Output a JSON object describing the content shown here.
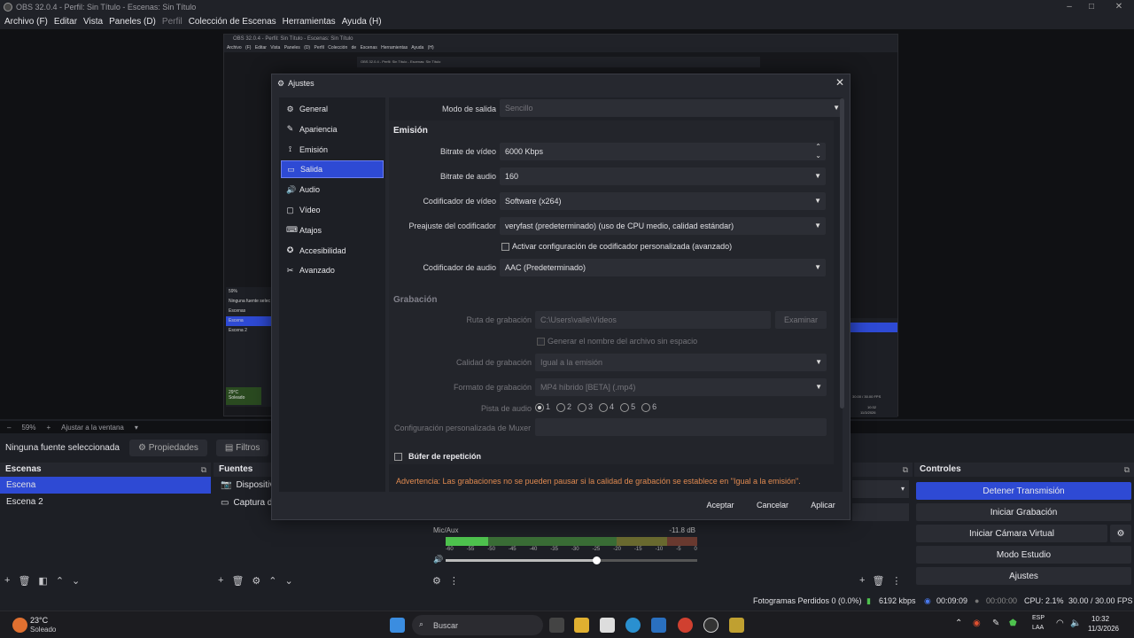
{
  "window": {
    "title": "OBS 32.0.4 - Perfil: Sin Título - Escenas: Sin Título"
  },
  "menu": [
    "Archivo (F)",
    "Editar",
    "Vista",
    "Paneles (D)",
    "Perfil",
    "Colección de Escenas",
    "Herramientas",
    "Ayuda (H)"
  ],
  "preview": {
    "zoom": "59%",
    "fit": "Ajustar a la ventana",
    "no_source": "Ninguna fuente seleccionada",
    "properties": "Propiedades",
    "filters": "Filtros"
  },
  "scenes_dock": {
    "title": "Escenas",
    "items": [
      "Escena",
      "Escena 2"
    ]
  },
  "sources_dock": {
    "title": "Fuentes",
    "items": [
      "Dispositivo",
      "Captura de"
    ]
  },
  "mixer": {
    "name": "Mic/Aux",
    "db": "-11.8 dB",
    "scale": [
      "-60",
      "-55",
      "-50",
      "-45",
      "-40",
      "-35",
      "-30",
      "-25",
      "-20",
      "-15",
      "-10",
      "-5",
      "0"
    ],
    "level": 0.17,
    "volume": 0.6
  },
  "controls": {
    "title": "Controles",
    "buttons": [
      "Detener Transmisión",
      "Iniciar Grabación",
      "Iniciar Cámara Virtual",
      "Modo Estudio",
      "Ajustes"
    ]
  },
  "status": {
    "dropped": "Fotogramas Perdidos 0 (0.0%)",
    "bitrate": "6192 kbps",
    "stream_time": "00:09:09",
    "rec_time": "00:00:00",
    "cpu": "CPU: 2.1%",
    "fps": "30.00 / 30.00 FPS"
  },
  "taskbar": {
    "weather_temp": "23°C",
    "weather_desc": "Soleado",
    "search": "Buscar",
    "lang1": "ESP",
    "lang2": "LAA",
    "time": "10:32",
    "date": "11/3/2026"
  },
  "nested": {
    "title": "OBS 32.0.4 - Perfil: Sin Título - Escenas: Sin Título",
    "menu": "Archivo (F)  Editar  Vista  Paneles (D)  Perfil  Colección de Escenas  Herramientas  Ayuda (H)",
    "inner": "OBS 32.0.4 - Perfil: Sin Título - Escenas: Sin Título",
    "zoom": "59%",
    "no_source": "Ninguna fuente selec",
    "scenes_label": "Escenas",
    "scenes": [
      "Escena",
      "Escena 2"
    ],
    "fps": "30.00 / 30.00 FPS",
    "time": "10:32",
    "date": "11/3/2026",
    "weather": "29°C",
    "weather_desc": "Soleado"
  },
  "settings": {
    "title": "Ajustes",
    "nav": [
      {
        "label": "General",
        "icon": "gear-icon"
      },
      {
        "label": "Apariencia",
        "icon": "brush-icon"
      },
      {
        "label": "Emisión",
        "icon": "antenna-icon"
      },
      {
        "label": "Salida",
        "icon": "monitor-icon"
      },
      {
        "label": "Audio",
        "icon": "speaker-icon"
      },
      {
        "label": "Vídeo",
        "icon": "display-icon"
      },
      {
        "label": "Atajos",
        "icon": "keyboard-icon"
      },
      {
        "label": "Accesibilidad",
        "icon": "accessibility-icon"
      },
      {
        "label": "Avanzado",
        "icon": "tools-icon"
      }
    ],
    "selected": "Salida",
    "output_mode_label": "Modo de salida",
    "output_mode": "Sencillo",
    "streaming_section": "Emisión",
    "video_bitrate_label": "Bitrate de vídeo",
    "video_bitrate": "6000 Kbps",
    "audio_bitrate_label": "Bitrate de audio",
    "audio_bitrate": "160",
    "video_encoder_label": "Codificador de vídeo",
    "video_encoder": "Software (x264)",
    "preset_label": "Preajuste del codificador",
    "preset": "veryfast (predeterminado) (uso de CPU medio, calidad estándar)",
    "custom_encoder": "Activar configuración de codificador personalizada (avanzado)",
    "audio_encoder_label": "Codificador de audio",
    "audio_encoder": "AAC (Predeterminado)",
    "recording_section": "Grabación",
    "rec_path_label": "Ruta de grabación",
    "rec_path": "C:\\Users\\valle\\Videos",
    "browse": "Examinar",
    "no_space": "Generar el nombre del archivo sin espacio",
    "rec_quality_label": "Calidad de grabación",
    "rec_quality": "Igual a la emisión",
    "rec_format_label": "Formato de grabación",
    "rec_format": "MP4 híbrido [BETA] (.mp4)",
    "audio_track_label": "Pista de audio",
    "tracks": [
      "1",
      "2",
      "3",
      "4",
      "5",
      "6"
    ],
    "muxer_label": "Configuración personalizada de Muxer",
    "replay_buffer": "Búfer de repetición",
    "warning": "Advertencia: Las grabaciones no se pueden pausar si la calidad de grabación se establece en \"Igual a la emisión\".",
    "accept": "Aceptar",
    "cancel": "Cancelar",
    "apply": "Aplicar"
  }
}
